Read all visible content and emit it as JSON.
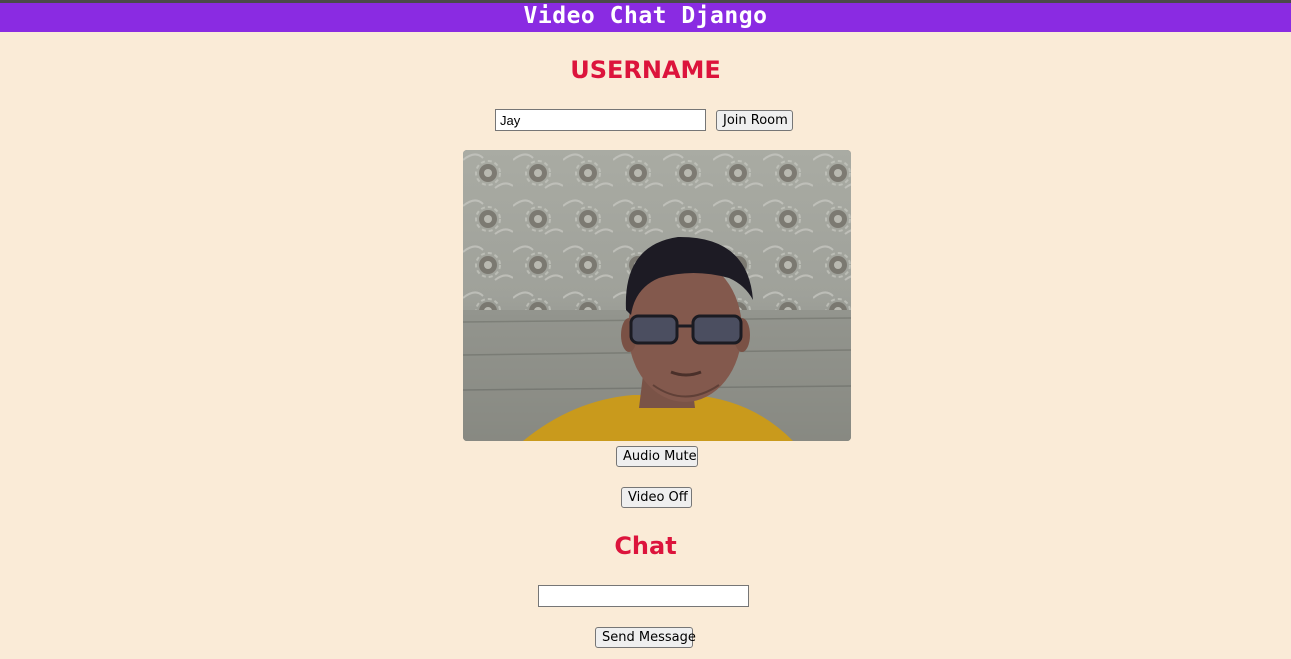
{
  "header": {
    "title": "Video Chat Django"
  },
  "username_section": {
    "heading": "USERNAME",
    "input_value": "Jay",
    "join_button_label": "Join Room"
  },
  "video": {
    "description_icon": "webcam-feed"
  },
  "controls": {
    "audio_button_label": "Audio Mute",
    "video_button_label": "Video Off"
  },
  "chat": {
    "heading": "Chat",
    "message_input_value": "",
    "send_button_label": "Send Message"
  },
  "colors": {
    "header_bg": "#8A2BE2",
    "page_bg": "#FAEBD7",
    "heading_text": "#DC143C"
  }
}
